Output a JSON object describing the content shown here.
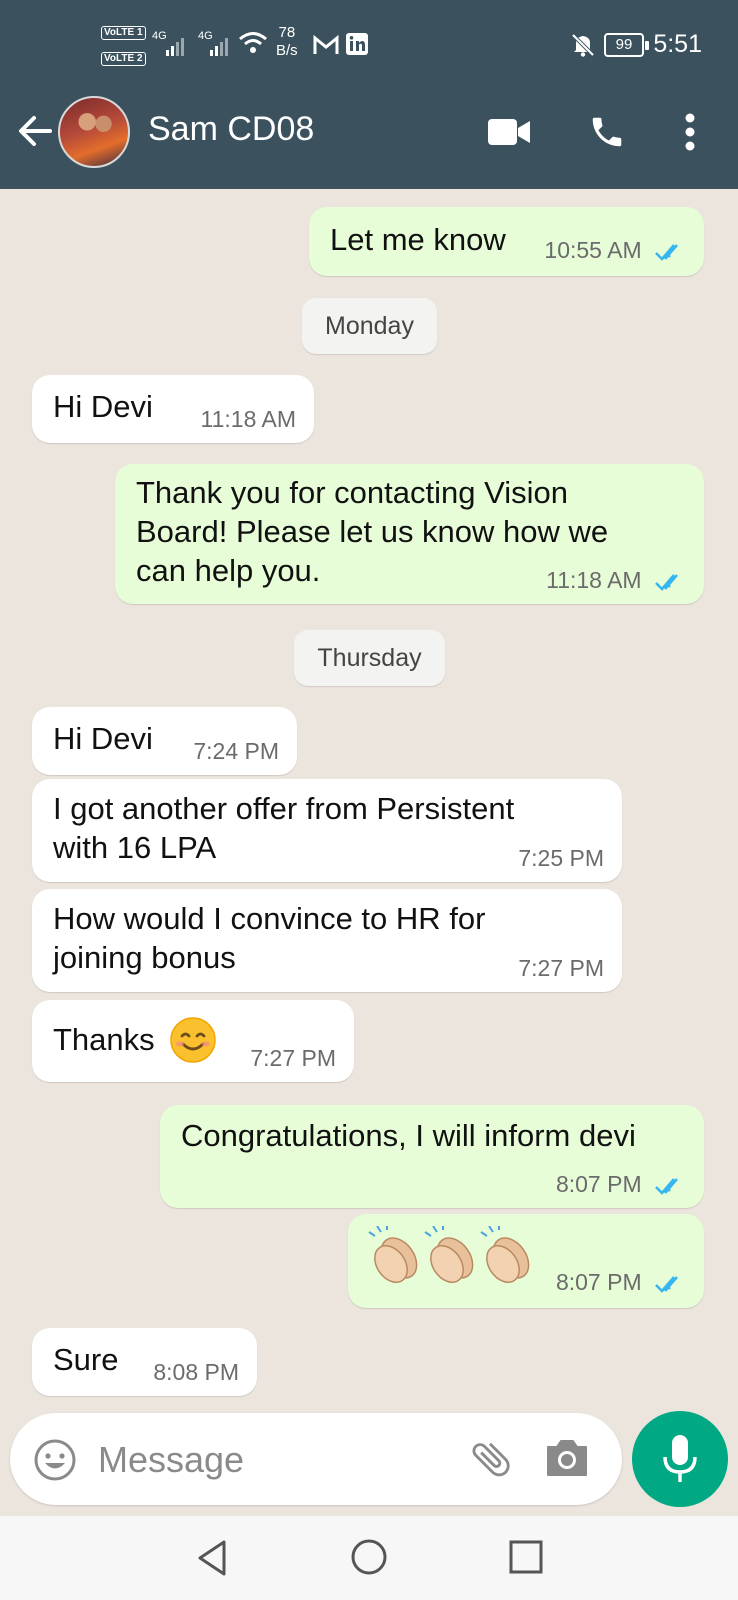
{
  "status_bar": {
    "volte1": "VoLTE 1",
    "volte2": "VoLTE 2",
    "net1": "4G",
    "net2": "4G",
    "net_speed_value": "78",
    "net_speed_unit": "B/s",
    "battery": "99",
    "time": "5:51"
  },
  "header": {
    "contact_name": "Sam CD08"
  },
  "messages": [
    {
      "dir": "out",
      "text_lines": [
        "Let me know"
      ],
      "time": "10:55 AM",
      "read": true
    },
    {
      "type": "day",
      "label": "Monday"
    },
    {
      "dir": "in",
      "text_lines": [
        "Hi Devi"
      ],
      "time": "11:18 AM"
    },
    {
      "dir": "out",
      "text_lines": [
        "Thank you for contacting Vision",
        "Board! Please let us know how we",
        "can help you."
      ],
      "time": "11:18 AM",
      "read": true
    },
    {
      "type": "day",
      "label": "Thursday"
    },
    {
      "dir": "in",
      "text_lines": [
        "Hi Devi"
      ],
      "time": "7:24 PM"
    },
    {
      "dir": "in",
      "text_lines": [
        "I got another offer from Persistent",
        "with 16 LPA"
      ],
      "time": "7:25 PM"
    },
    {
      "dir": "in",
      "text_lines": [
        "How would I convince to HR for",
        "joining bonus"
      ],
      "time": "7:27 PM"
    },
    {
      "dir": "in",
      "text_lines": [
        "Thanks"
      ],
      "emoji": "smiling-face",
      "time": "7:27 PM"
    },
    {
      "dir": "out",
      "text_lines": [
        "Congratulations, I will inform devi"
      ],
      "time": "8:07 PM",
      "read": true
    },
    {
      "dir": "out",
      "emoji_row": [
        "clapping-hands",
        "clapping-hands",
        "clapping-hands"
      ],
      "time": "8:07 PM",
      "read": true
    },
    {
      "dir": "in",
      "text_lines": [
        "Sure"
      ],
      "time": "8:08 PM"
    }
  ],
  "input": {
    "placeholder": "Message"
  },
  "colors": {
    "header_bg": "#3b525e",
    "chat_bg": "#ece5dd",
    "outgoing_bubble": "#e7fdd8",
    "incoming_bubble": "#ffffff",
    "read_ticks": "#34b7f1",
    "mic_button": "#00a884"
  },
  "icons": {
    "header": [
      "back-arrow-icon",
      "video-call-icon",
      "voice-call-icon",
      "more-options-icon"
    ],
    "input": [
      "emoji-icon",
      "attach-icon",
      "camera-icon",
      "mic-icon"
    ],
    "nav": [
      "nav-back-icon",
      "nav-home-icon",
      "nav-recents-icon"
    ]
  }
}
